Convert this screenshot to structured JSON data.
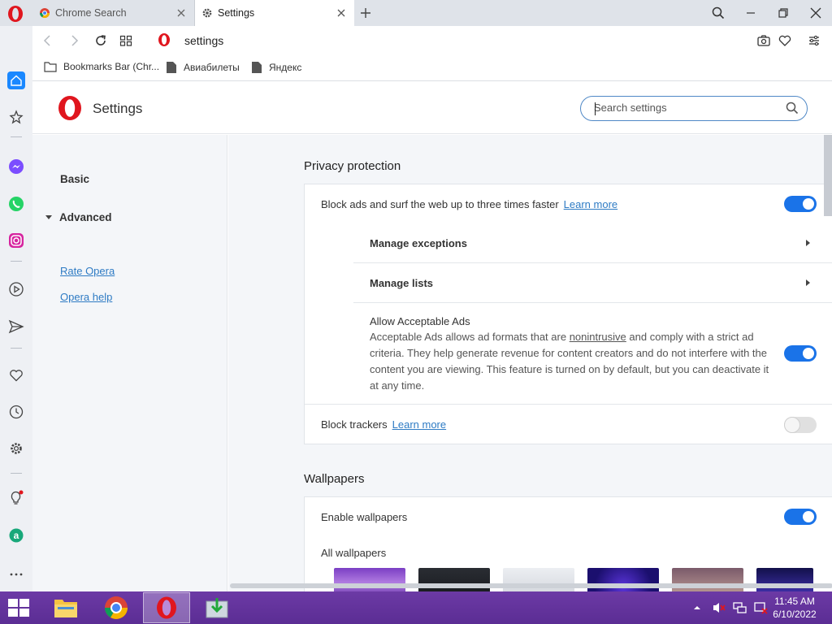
{
  "browser": {
    "tabs": [
      {
        "label": "Chrome Search",
        "active": false
      },
      {
        "label": "Settings",
        "active": true
      }
    ],
    "address": {
      "url": "settings"
    },
    "bookmarks": [
      {
        "label": "Bookmarks Bar (Chr..."
      },
      {
        "label": "Авиабилеты"
      },
      {
        "label": "Яндекс"
      }
    ]
  },
  "settings": {
    "title": "Settings",
    "search_placeholder": "Search settings",
    "nav": {
      "basic": "Basic",
      "advanced": "Advanced",
      "rate": "Rate Opera",
      "help": "Opera help"
    },
    "privacy": {
      "title": "Privacy protection",
      "block_ads": "Block ads and surf the web up to three times faster",
      "learn_more": "Learn more",
      "manage_exceptions": "Manage exceptions",
      "manage_lists": "Manage lists",
      "acceptable_ads_title": "Allow Acceptable Ads",
      "acceptable_ads_desc_1": "Acceptable Ads allows ad formats that are ",
      "acceptable_ads_desc_link": "nonintrusive",
      "acceptable_ads_desc_2": " and comply with a strict ad criteria. They help generate revenue for content creators and do not interfere with the content you are viewing. This feature is turned on by default, but you can deactivate it at any time.",
      "block_trackers": "Block trackers",
      "trackers_learn_more": "Learn more",
      "toggles": {
        "block_ads": true,
        "acceptable_ads": true,
        "block_trackers": false
      }
    },
    "wallpapers": {
      "title": "Wallpapers",
      "enable": "Enable wallpapers",
      "enable_on": true,
      "all": "All wallpapers"
    }
  },
  "taskbar": {
    "time": "11:45 AM",
    "date": "6/10/2022"
  },
  "colors": {
    "accent": "#1a73e8",
    "link": "#2e7bc4",
    "opera_red": "#e0161e",
    "taskbar": "#5b2d94"
  }
}
